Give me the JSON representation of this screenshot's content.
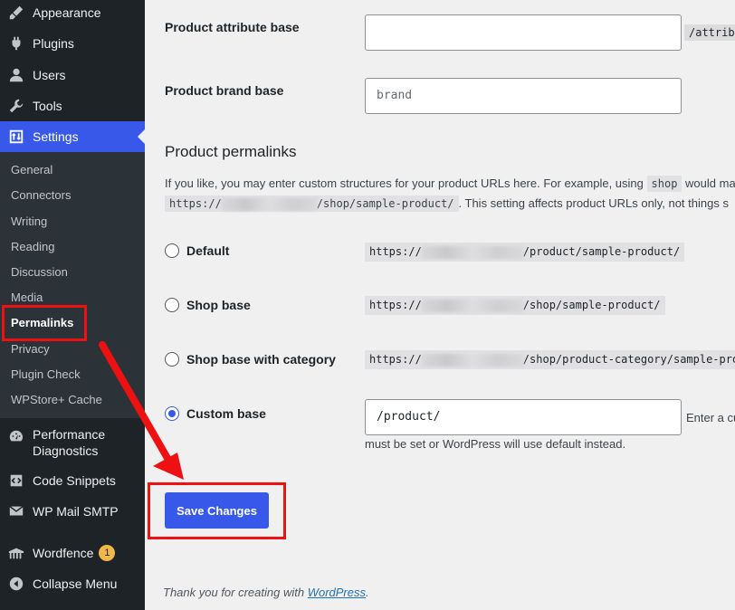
{
  "sidebar": {
    "menu": [
      {
        "label": "Appearance",
        "icon": "paintbrush-icon"
      },
      {
        "label": "Plugins",
        "icon": "plugin-icon"
      },
      {
        "label": "Users",
        "icon": "user-icon"
      },
      {
        "label": "Tools",
        "icon": "wrench-icon"
      },
      {
        "label": "Settings",
        "icon": "sliders-icon"
      }
    ],
    "submenu": [
      "General",
      "Connectors",
      "Writing",
      "Reading",
      "Discussion",
      "Media",
      "Permalinks",
      "Privacy",
      "Plugin Check",
      "WPStore+ Cache"
    ],
    "lower_menu": [
      {
        "label_line1": "Performance",
        "label_line2": "Diagnostics",
        "icon": "dashboard-icon"
      },
      {
        "label": "Code Snippets",
        "icon": "code-icon"
      },
      {
        "label": "WP Mail SMTP",
        "icon": "mail-icon"
      },
      {
        "label": "Wordfence",
        "icon": "wordfence-icon",
        "badge": "1"
      },
      {
        "label": "Collapse Menu",
        "icon": "collapse-icon"
      }
    ],
    "accent_color": "#3858e9"
  },
  "main": {
    "attribute_base": {
      "label": "Product attribute base",
      "value": "",
      "suffix": "/attribu"
    },
    "brand_base": {
      "label": "Product brand base",
      "placeholder": "brand"
    },
    "section_title": "Product permalinks",
    "description": {
      "line1_start": "If you like, you may enter custom structures for your product URLs here. For example, using",
      "line1_code": "shop",
      "line1_end": "would mak",
      "line2_code_start": "https://",
      "line2_code_end": "/shop/sample-product/",
      "line2_end": ". This setting affects product URLs only, not things s"
    },
    "options": [
      {
        "label": "Default",
        "url_prefix": "https://",
        "url_suffix": "/product/sample-product/",
        "checked": false
      },
      {
        "label": "Shop base",
        "url_prefix": "https://",
        "url_suffix": "/shop/sample-product/",
        "checked": false
      },
      {
        "label": "Shop base with category",
        "url_prefix": "https://",
        "url_suffix": "/shop/product-category/sample-pro",
        "checked": false
      },
      {
        "label": "Custom base",
        "checked": true
      }
    ],
    "custom_base": {
      "value": "/product/",
      "hint": "Enter a cu",
      "hint_line2": "must be set or WordPress will use default instead."
    },
    "save_label": "Save Changes",
    "footer_text": "Thank you for creating with ",
    "footer_link": "WordPress",
    "footer_end": "."
  }
}
